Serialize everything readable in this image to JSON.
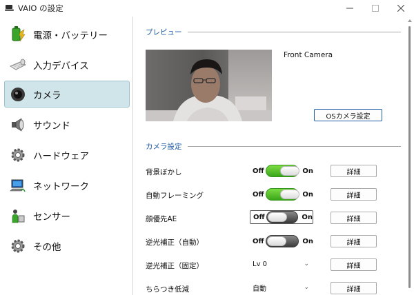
{
  "window": {
    "title": "VAIO の設定",
    "minimize_icon": "minimize-icon",
    "maximize_icon": "maximize-icon",
    "close_icon": "close-icon"
  },
  "sidebar": {
    "items": [
      {
        "label": "電源・バッテリー",
        "icon": "battery-icon",
        "selected": false
      },
      {
        "label": "入力デバイス",
        "icon": "keyboard-mouse-icon",
        "selected": false
      },
      {
        "label": "カメラ",
        "icon": "camera-icon",
        "selected": true
      },
      {
        "label": "サウンド",
        "icon": "speaker-icon",
        "selected": false
      },
      {
        "label": "ハードウェア",
        "icon": "gear-icon",
        "selected": false
      },
      {
        "label": "ネットワーク",
        "icon": "network-icon",
        "selected": false
      },
      {
        "label": "センサー",
        "icon": "sensor-icon",
        "selected": false
      },
      {
        "label": "その他",
        "icon": "gear-icon",
        "selected": false
      }
    ]
  },
  "preview": {
    "heading": "プレビュー",
    "camera_name": "Front Camera",
    "os_settings_button": "OSカメラ設定"
  },
  "camera_settings": {
    "heading": "カメラ設定",
    "rows": [
      {
        "label": "背景ぼかし",
        "type": "toggle",
        "off": "Off",
        "on": "On",
        "state": "on",
        "detail": "詳細"
      },
      {
        "label": "自動フレーミング",
        "type": "toggle",
        "off": "Off",
        "on": "On",
        "state": "on",
        "detail": "詳細"
      },
      {
        "label": "顔優先AE",
        "type": "toggle",
        "off": "Off",
        "on": "On",
        "state": "off",
        "detail": "詳細"
      },
      {
        "label": "逆光補正（自動）",
        "type": "toggle",
        "off": "Off",
        "on": "On",
        "state": "off",
        "detail": "詳細"
      },
      {
        "label": "逆光補正（固定）",
        "type": "select",
        "value": "Lv 0",
        "detail": "詳細"
      },
      {
        "label": "ちらつき低減",
        "type": "select",
        "value": "自動",
        "detail": "詳細"
      }
    ]
  },
  "colors": {
    "accent": "#1b56a0",
    "selected_bg": "#cfe5ea",
    "toggle_on": "#4cbf2a",
    "toggle_off": "#555555"
  }
}
